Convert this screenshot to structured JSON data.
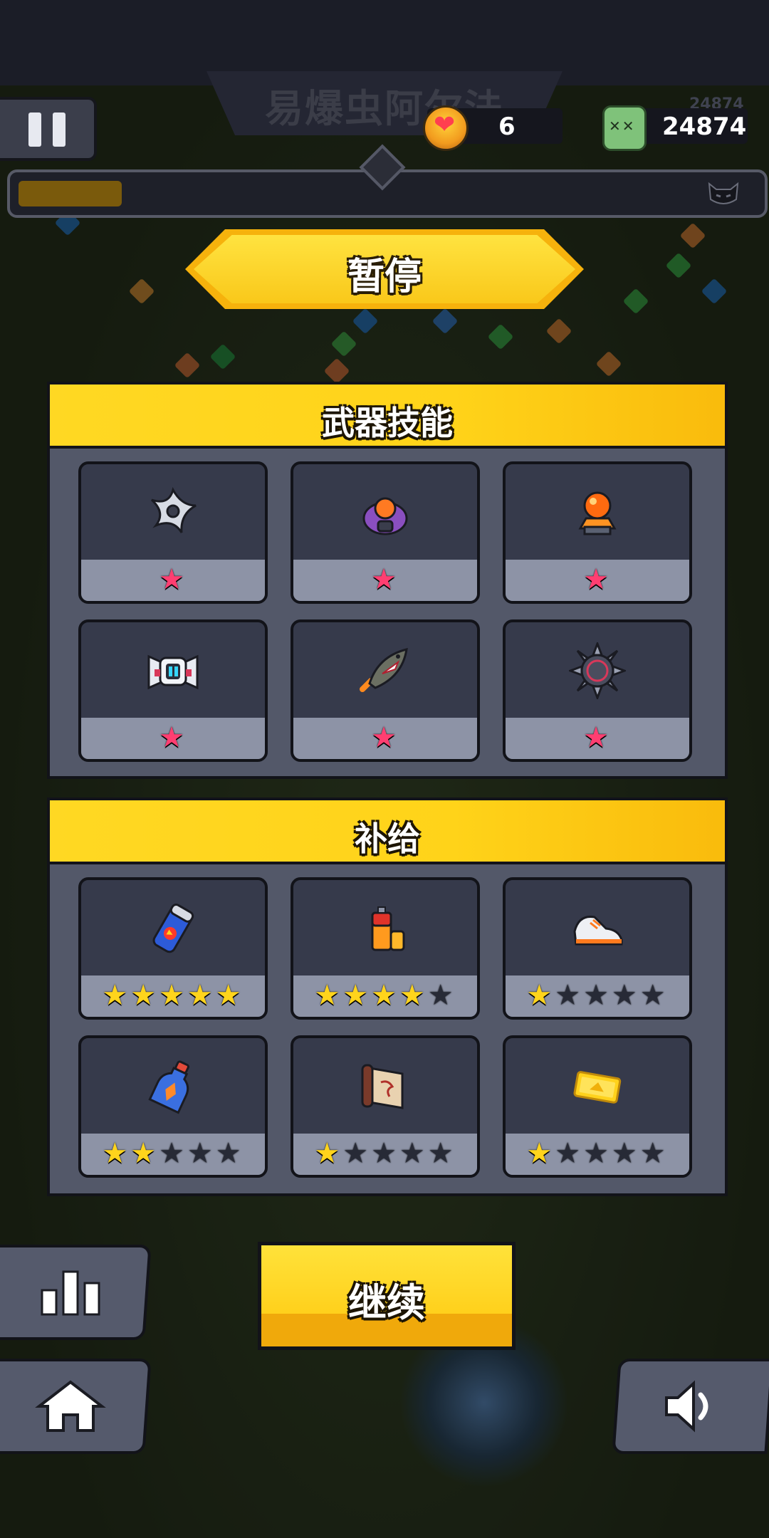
{
  "hud": {
    "level_title": "易爆虫阿尔法",
    "hearts": "6",
    "kills": "24874",
    "kills_ghost": "24874",
    "progress": 0.14
  },
  "pause": {
    "title": "暂停"
  },
  "weapon_skills": {
    "title": "武器技能",
    "items": [
      {
        "icon": "shuriken-icon",
        "stars": 1
      },
      {
        "icon": "drone-turret-icon",
        "stars": 1
      },
      {
        "icon": "energy-orb-icon",
        "stars": 1
      },
      {
        "icon": "robot-guard-icon",
        "stars": 1
      },
      {
        "icon": "shark-missile-icon",
        "stars": 1
      },
      {
        "icon": "spiked-mine-icon",
        "stars": 1
      }
    ]
  },
  "supplies": {
    "title": "补给",
    "max_stars": 5,
    "items": [
      {
        "icon": "energy-drink-icon",
        "stars": 5
      },
      {
        "icon": "battery-icon",
        "stars": 4
      },
      {
        "icon": "sneaker-icon",
        "stars": 1
      },
      {
        "icon": "potion-bottle-icon",
        "stars": 2
      },
      {
        "icon": "scroll-book-icon",
        "stars": 1
      },
      {
        "icon": "gold-ticket-icon",
        "stars": 1
      }
    ]
  },
  "buttons": {
    "continue": "继续",
    "stats": "stats-icon",
    "home": "home-icon",
    "sound": "speaker-icon"
  },
  "colors": {
    "accent_yellow": "#ffd319",
    "panel_bg": "#535869",
    "star_gold": "#ffd41c",
    "star_pink": "#ff3e71"
  }
}
